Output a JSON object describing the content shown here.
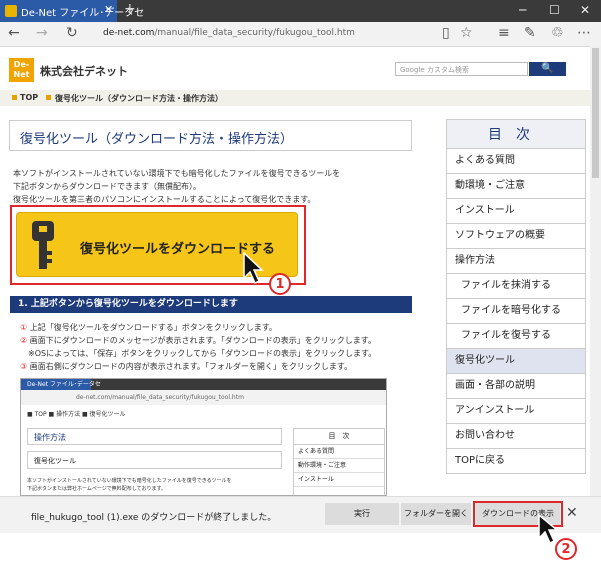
{
  "browser": {
    "tab_title": "De-Net ファイル･データセ",
    "tab_close": "✕",
    "new_tab": "+",
    "url_prefix": "de-net.com",
    "url_path": "/manual/file_data_security/fukugou_tool.htm"
  },
  "header": {
    "logo_text": "De-Net",
    "company": "株式会社デネット",
    "search_placeholder": "Google カスタム検索",
    "search_button": "🔍"
  },
  "breadcrumb": {
    "top": "TOP",
    "current": "復号化ツール（ダウンロード方法・操作方法）"
  },
  "main": {
    "title": "復号化ツール（ダウンロード方法・操作方法）",
    "desc1": "本ソフトがインストールされていない環境下でも暗号化したファイルを復号できるツールを",
    "desc2": "下記ボタンからダウンロードできます（無償配布）。",
    "desc3": "復号化ツールを第三者のパソコンにインストールすることによって復号化できます。",
    "download_button": "復号化ツールをダウンロードする",
    "marker1": "1",
    "section_heading": "1. 上記ボタンから復号化ツールをダウンロードします",
    "steps": [
      {
        "n": "①",
        "text": " 上記「復号化ツールをダウンロードする」ボタンをクリックします。"
      },
      {
        "n": "②",
        "text": " 画面下にダウンロードのメッセージが表示されます。「ダウンロードの表示」をクリックします。"
      },
      {
        "n": "",
        "text": "　※OSによっては、「保存」ボタンをクリックしてから「ダウンロードの表示」をクリックします。"
      },
      {
        "n": "③",
        "text": " 画面右側にダウンロードの内容が表示されます。「フォルダーを開く」をクリックします。"
      }
    ]
  },
  "inner_screenshot": {
    "tab": "De-Net ファイル･データセ",
    "url": "de-net.com/manual/file_data_security/fukugou_tool.htm",
    "crumb": "■ TOP ■ 操作方法 ■ 復号化ツール",
    "title": "操作方法",
    "subtitle": "復号化ツール",
    "text1": "本ソフトがインストールされていない環境下でも暗号化したファイルを復号できるツールを",
    "text2": "下記ボタンまたは弊社ホームページで無料配布しております。",
    "toc_head": "目　次",
    "toc_items": [
      "よくある質問",
      "動作環境・ご注意",
      "インストール"
    ]
  },
  "sidebar": {
    "heading": "目次",
    "items": [
      {
        "label": "よくある質問"
      },
      {
        "label": "動環境・ご注意"
      },
      {
        "label": "インストール"
      },
      {
        "label": "ソフトウェアの概要"
      },
      {
        "label": "操作方法"
      },
      {
        "label": "ファイルを抹消する"
      },
      {
        "label": "ファイルを暗号化する"
      },
      {
        "label": "ファイルを復号する"
      },
      {
        "label": "復号化ツール"
      },
      {
        "label": "画面・各部の説明"
      },
      {
        "label": "アンインストール"
      },
      {
        "label": "お問い合わせ"
      },
      {
        "label": "TOPに戻る"
      }
    ]
  },
  "download_bar": {
    "message": "file_hukugo_tool (1).exe のダウンロードが終了しました。",
    "run": "実行",
    "open_folder": "フォルダーを開く",
    "view_downloads": "ダウンロードの表示",
    "close": "✕",
    "marker2": "2"
  },
  "colors": {
    "accent": "#1d3a7a",
    "highlight": "#e0282a",
    "button": "#f5c518"
  }
}
